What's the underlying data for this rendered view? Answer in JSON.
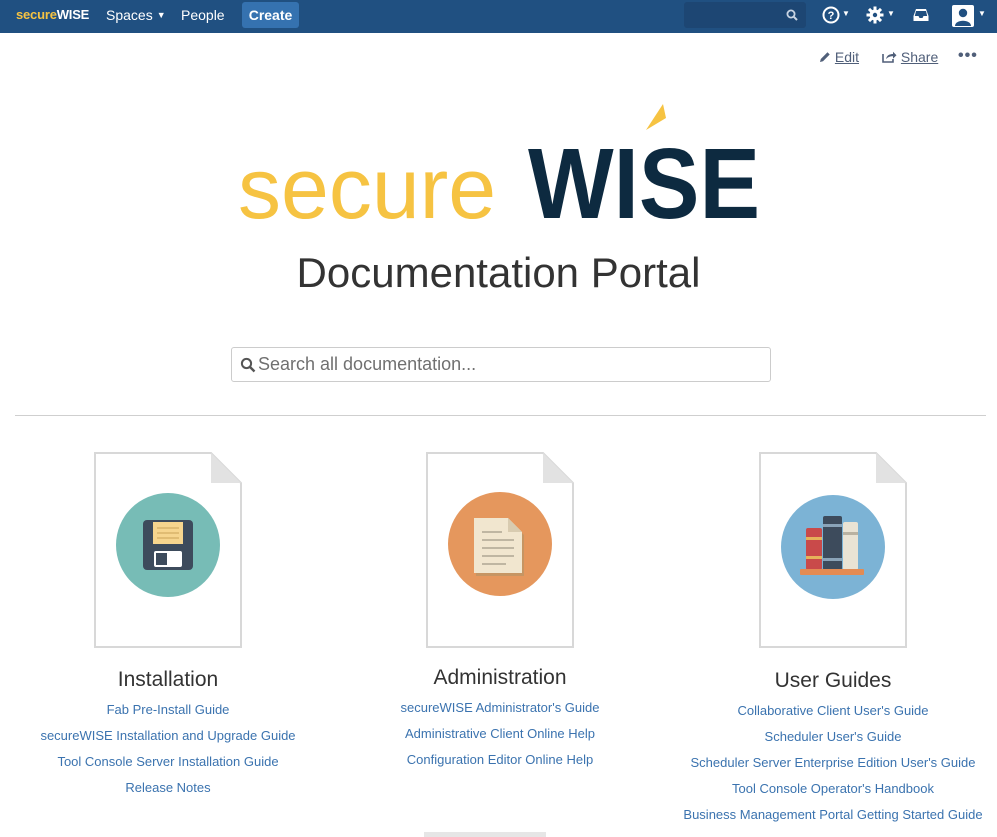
{
  "nav": {
    "brand_prefix": "secure",
    "brand_suffix": "WISE",
    "spaces_label": "Spaces",
    "people_label": "People",
    "create_label": "Create",
    "search_placeholder": "",
    "icons": [
      "search-icon",
      "help-icon",
      "gear-icon",
      "inbox-icon",
      "user-avatar-icon"
    ]
  },
  "page_actions": {
    "edit_label": "Edit",
    "share_label": "Share",
    "more_label": "•••"
  },
  "hero": {
    "logo_prefix": "secure",
    "logo_suffix": "WISE",
    "title": "Documentation Portal",
    "search_placeholder": "Search all documentation..."
  },
  "colors": {
    "nav_bg": "#205081",
    "create_bg": "#3572b0",
    "logo_yellow": "#f6c342",
    "logo_navy": "#0d2a40",
    "link": "#3b73af",
    "installation_circle": "#77bcb6",
    "administration_circle": "#e5975d",
    "user_guides_circle": "#7cb3d5"
  },
  "columns": [
    {
      "title": "Installation",
      "icon": "floppy-disk-icon",
      "links": [
        "Fab Pre-Install Guide",
        "secureWISE Installation and Upgrade Guide",
        "Tool Console Server Installation Guide",
        "Release Notes"
      ]
    },
    {
      "title": "Administration",
      "icon": "document-icon",
      "links": [
        "secureWISE Administrator's Guide",
        "Administrative Client Online Help",
        "Configuration Editor Online Help"
      ]
    },
    {
      "title": "User Guides",
      "icon": "books-icon",
      "links": [
        "Collaborative Client User's Guide",
        "Scheduler User's Guide",
        "Scheduler Server Enterprise Edition User's Guide",
        "Tool Console Operator's Handbook",
        "Business Management Portal Getting Started Guide"
      ]
    }
  ]
}
